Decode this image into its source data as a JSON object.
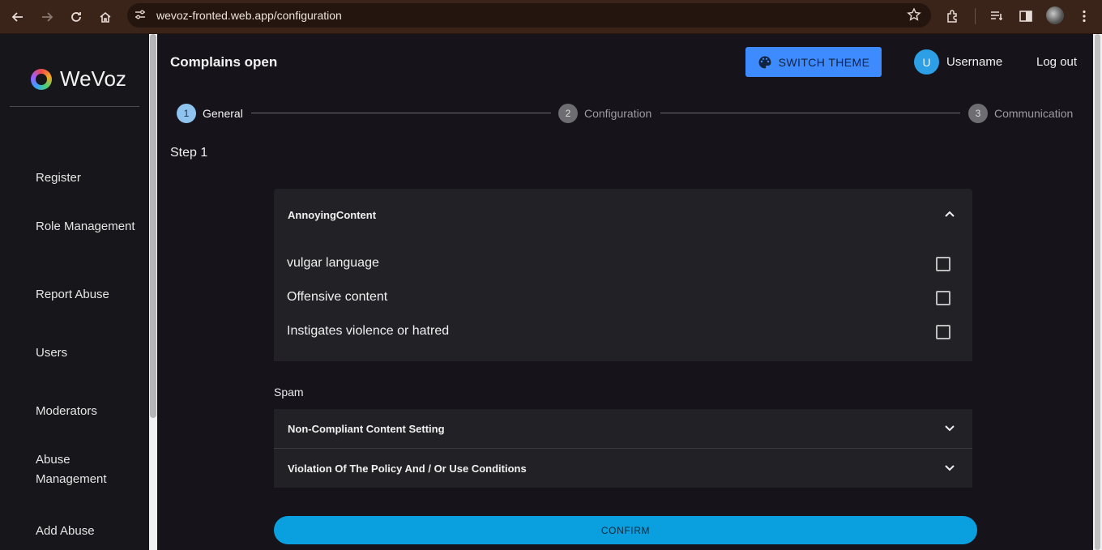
{
  "browser": {
    "url": "wevoz-fronted.web.app/configuration"
  },
  "sidebar": {
    "brand": "WeVoz",
    "items": [
      {
        "label": "Register"
      },
      {
        "label": "Role Management"
      },
      {
        "label": "Report Abuse"
      },
      {
        "label": "Users"
      },
      {
        "label": "Moderators"
      },
      {
        "label": "Abuse Management"
      },
      {
        "label": "Add Abuse"
      }
    ]
  },
  "header": {
    "title": "Complains open",
    "theme_button": "SWITCH THEME",
    "avatar_initial": "U",
    "username": "Username",
    "logout": "Log out"
  },
  "stepper": {
    "steps": [
      {
        "number": "1",
        "label": "General",
        "active": true
      },
      {
        "number": "2",
        "label": "Configuration",
        "active": false
      },
      {
        "number": "3",
        "label": "Communication",
        "active": false
      }
    ]
  },
  "content": {
    "step_heading": "Step 1",
    "open_panel": {
      "title": "AnnoyingContent",
      "options": [
        {
          "label": "vulgar language",
          "checked": false
        },
        {
          "label": "Offensive content",
          "checked": false
        },
        {
          "label": "Instigates violence or hatred",
          "checked": false
        }
      ]
    },
    "spam_label": "Spam",
    "closed_panels": [
      {
        "title": "Non-Compliant Content Setting"
      },
      {
        "title": "Violation Of The Policy And / Or Use Conditions"
      }
    ],
    "confirm_button": "CONFIRM"
  },
  "colors": {
    "accent": "#3d8bff",
    "confirm": "#0aa0e0",
    "avatar": "#2d9fe6",
    "browser_bar": "#3a2318"
  }
}
